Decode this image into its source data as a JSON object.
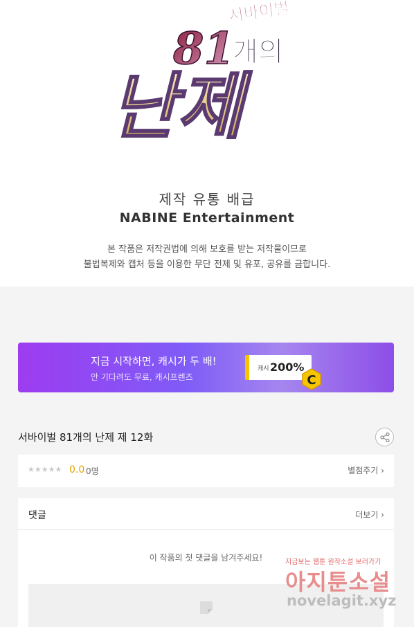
{
  "logo": {
    "subtitle": "서바이벌",
    "number": "81",
    "word": "개의",
    "main": "난제"
  },
  "credits": {
    "label": "제작 유통 배급",
    "company": "NABINE Entertainment",
    "copyright_line1": "본 작품은 저작권법에 의해 보호를 받는 저작물이므로",
    "copyright_line2": "불법복제와 캡처 등을 이용한 무단 전제 및 유포, 공유를 금합니다."
  },
  "banner": {
    "title": "지금 시작하면, 캐시가 두 배!",
    "subtitle": "안 기다려도 무료, 캐시프렌즈",
    "ticket_small": "캐시",
    "ticket_big": "200%",
    "coin_letter": "C"
  },
  "episode": {
    "title": "서바이벌 81개의 난제 제 12화"
  },
  "rating": {
    "stars": "★★★★★",
    "value": "0.0",
    "count": "0명",
    "rate_label": "별점주기",
    "chevron": "›"
  },
  "comments": {
    "title": "댓글",
    "more_label": "더보기",
    "chevron": "›",
    "empty_text": "이 작품의 첫 댓글을 남겨주세요!"
  },
  "watermark": {
    "top": "지금보는 웹툰 원작소설 보러가기",
    "mid": "아지툰소설",
    "bot": "novelagit.xyz"
  },
  "colors": {
    "banner_start": "#9d3cf0",
    "banner_end": "#8d4ee8",
    "accent_yellow": "#f5c400",
    "rating_color": "#e0a400"
  }
}
